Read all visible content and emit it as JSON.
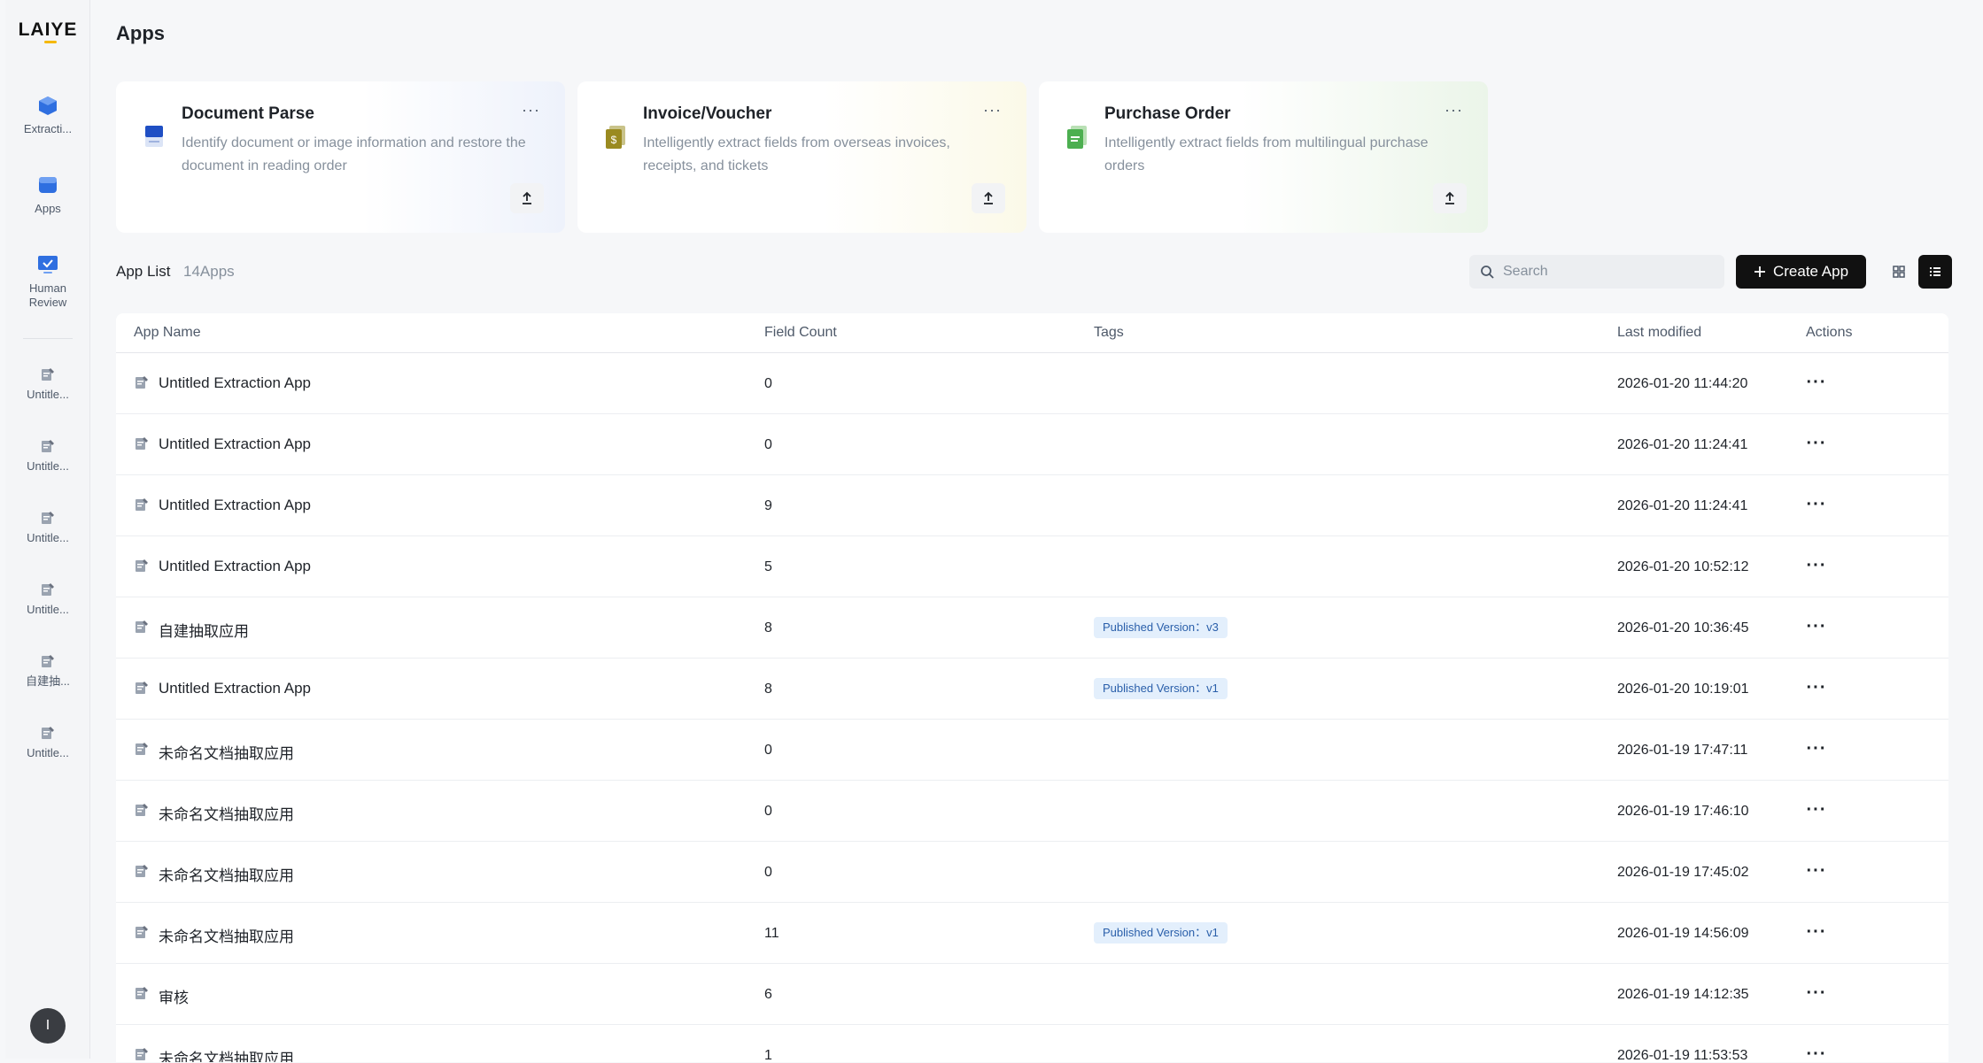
{
  "brand": {
    "logo_text": "LAIYE",
    "accent": "#f5b800"
  },
  "sidebar": {
    "nav": [
      {
        "label": "Extracti...",
        "icon": "cube-icon"
      },
      {
        "label": "Apps",
        "icon": "apps-icon"
      },
      {
        "label": "Human\nReview",
        "icon": "monitor-check-icon"
      }
    ],
    "apps": [
      {
        "label": "Untitle..."
      },
      {
        "label": "Untitle..."
      },
      {
        "label": "Untitle..."
      },
      {
        "label": "Untitle..."
      },
      {
        "label": "自建抽..."
      },
      {
        "label": "Untitle..."
      }
    ],
    "avatar_initial": "I"
  },
  "page": {
    "title": "Apps"
  },
  "templates": [
    {
      "title": "Document Parse",
      "desc": "Identify document or image information and restore the document in reading order",
      "icon": "document-parse-icon",
      "more": "···"
    },
    {
      "title": "Invoice/Voucher",
      "desc": "Intelligently extract fields from overseas invoices, receipts, and tickets",
      "icon": "invoice-icon",
      "more": "···"
    },
    {
      "title": "Purchase Order",
      "desc": "Intelligently extract fields from multilingual purchase orders",
      "icon": "purchase-order-icon",
      "more": "···"
    }
  ],
  "list": {
    "title": "App List",
    "count": "14Apps",
    "search_placeholder": "Search",
    "create_label": "Create App"
  },
  "table": {
    "columns": [
      "App Name",
      "Field Count",
      "Tags",
      "Last modified",
      "Actions"
    ],
    "rows": [
      {
        "name": "Untitled Extraction App",
        "count": "0",
        "tag": "",
        "date": "2026-01-20 11:44:20"
      },
      {
        "name": "Untitled Extraction App",
        "count": "0",
        "tag": "",
        "date": "2026-01-20 11:24:41"
      },
      {
        "name": "Untitled Extraction App",
        "count": "9",
        "tag": "",
        "date": "2026-01-20 11:24:41"
      },
      {
        "name": "Untitled Extraction App",
        "count": "5",
        "tag": "",
        "date": "2026-01-20 10:52:12"
      },
      {
        "name": "自建抽取应用",
        "count": "8",
        "tag": "Published Version：v3",
        "date": "2026-01-20 10:36:45"
      },
      {
        "name": "Untitled Extraction App",
        "count": "8",
        "tag": "Published Version：v1",
        "date": "2026-01-20 10:19:01"
      },
      {
        "name": "未命名文档抽取应用",
        "count": "0",
        "tag": "",
        "date": "2026-01-19 17:47:11"
      },
      {
        "name": "未命名文档抽取应用",
        "count": "0",
        "tag": "",
        "date": "2026-01-19 17:46:10"
      },
      {
        "name": "未命名文档抽取应用",
        "count": "0",
        "tag": "",
        "date": "2026-01-19 17:45:02"
      },
      {
        "name": "未命名文档抽取应用",
        "count": "11",
        "tag": "Published Version：v1",
        "date": "2026-01-19 14:56:09"
      },
      {
        "name": "审核",
        "count": "6",
        "tag": "",
        "date": "2026-01-19 14:12:35"
      },
      {
        "name": "未命名文档抽取应用",
        "count": "1",
        "tag": "",
        "date": "2026-01-19 11:53:53"
      }
    ],
    "actions_glyph": "···"
  }
}
